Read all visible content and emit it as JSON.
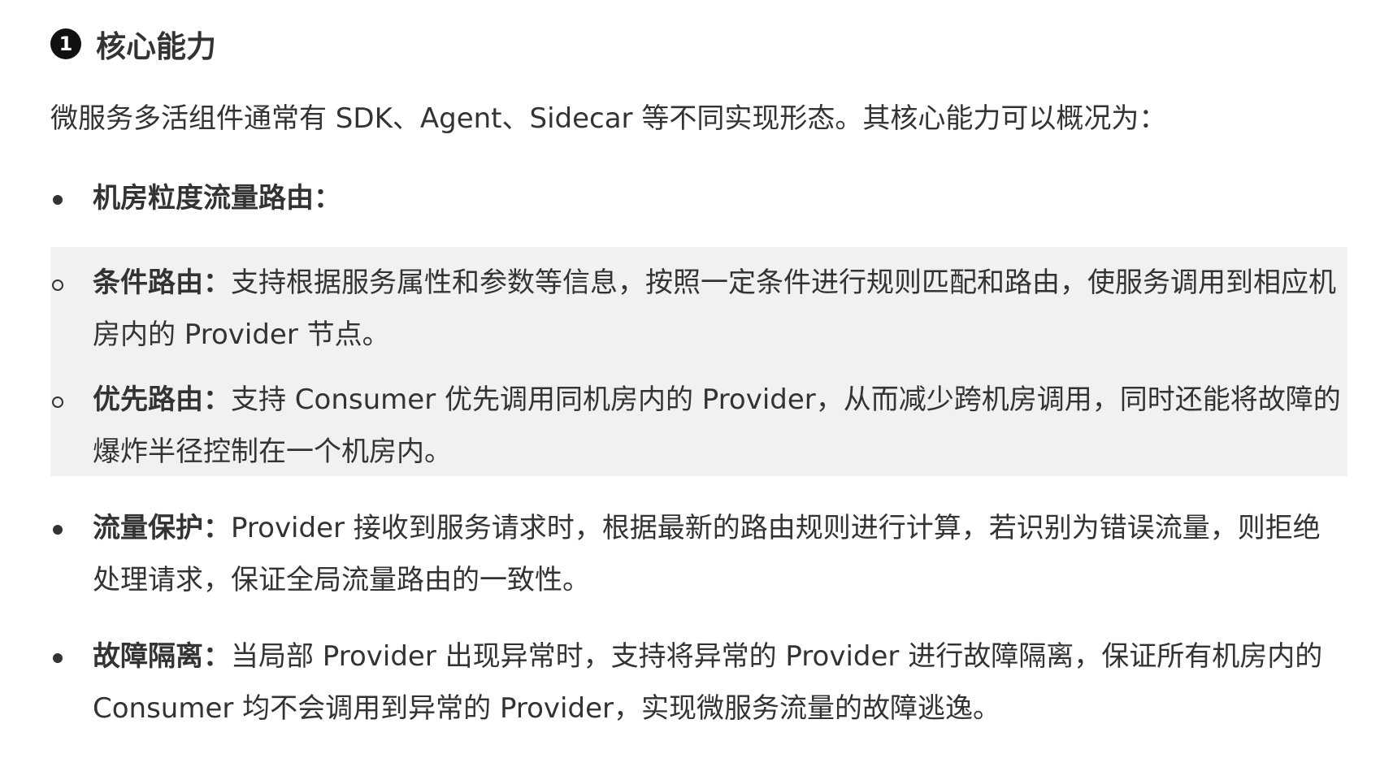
{
  "heading": {
    "number": "1",
    "title": "核心能力"
  },
  "intro": "微服务多活组件通常有 SDK、Agent、Sidecar 等不同实现形态。其核心能力可以概况为：",
  "items": [
    {
      "title": "机房粒度流量路由：",
      "text": ""
    },
    {
      "title": "条件路由：",
      "text": "支持根据服务属性和参数等信息，按照一定条件进行规则匹配和路由，使服务调用到相应机房内的 Provider 节点。"
    },
    {
      "title": "优先路由：",
      "text": "支持 Consumer 优先调用同机房内的 Provider，从而减少跨机房调用，同时还能将故障的爆炸半径控制在一个机房内。"
    },
    {
      "title": "流量保护：",
      "text": "Provider 接收到服务请求时，根据最新的路由规则进行计算，若识别为错误流量，则拒绝处理请求，保证全局流量路由的一致性。"
    },
    {
      "title": "故障隔离：",
      "text": "当局部 Provider 出现异常时，支持将异常的 Provider 进行故障隔离，保证所有机房内的 Consumer 均不会调用到异常的 Provider，实现微服务流量的故障逃逸。"
    }
  ]
}
